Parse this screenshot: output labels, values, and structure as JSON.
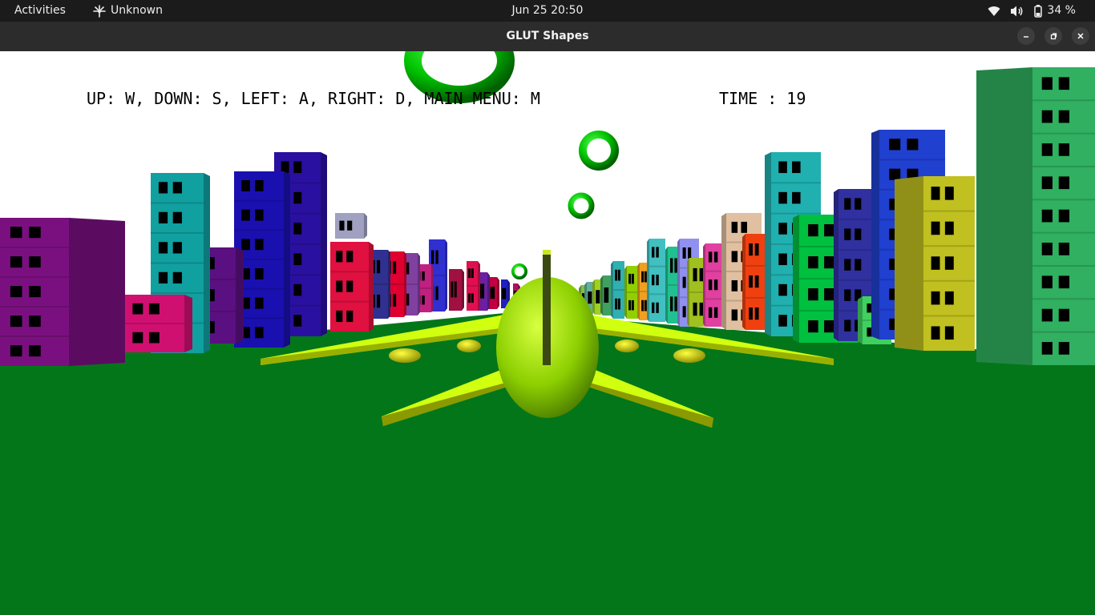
{
  "topbar": {
    "activities": "Activities",
    "app_name": "Unknown",
    "clock": "Jun 25  20:50",
    "battery": "34 %",
    "icons": [
      "network-icon",
      "wifi-icon",
      "volume-icon",
      "battery-icon"
    ]
  },
  "window": {
    "title": "GLUT Shapes",
    "controls": [
      "minimize-icon",
      "restore-icon",
      "close-icon"
    ]
  },
  "game": {
    "controls_text": "UP: W, DOWN: S, LEFT: A, RIGHT: D, MAIN MENU: M",
    "time_label": "TIME : 19",
    "time_value": 19,
    "colors": {
      "sky": "#ffffff",
      "ground": "#04761a",
      "plane": "#b8f000",
      "rings": "#00d000"
    }
  }
}
